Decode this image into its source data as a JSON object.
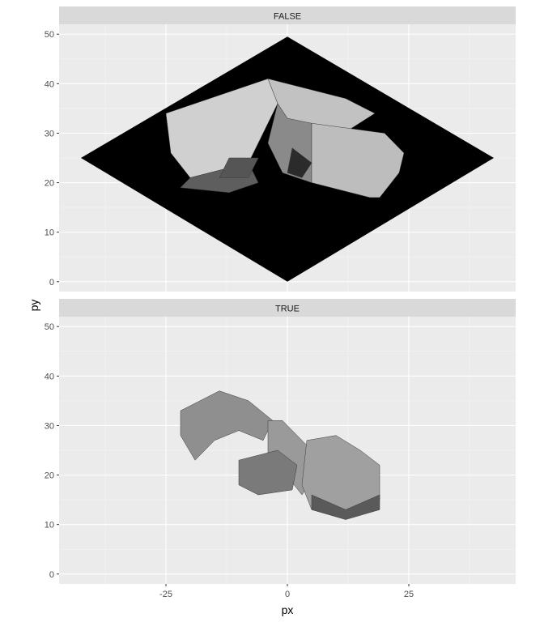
{
  "chart_data": {
    "type": "heatmap",
    "description_free": true,
    "xlabel": "px",
    "ylabel": "py",
    "xlim": [
      -47,
      47
    ],
    "ylim": [
      -2,
      52
    ],
    "x_ticks": [
      -25,
      0,
      25
    ],
    "x_tick_labels": [
      "-25",
      "0",
      "25"
    ],
    "y_ticks": [
      0,
      10,
      20,
      30,
      40,
      50
    ],
    "y_tick_labels": [
      "0",
      "10",
      "20",
      "30",
      "40",
      "50"
    ],
    "grid": true,
    "legend": "none",
    "facets": [
      {
        "strip_label": "FALSE",
        "ground_plane": [
          [
            0,
            0
          ],
          [
            42.5,
            25
          ],
          [
            0,
            49.5
          ],
          [
            -42.5,
            25
          ]
        ],
        "blocks": [
          {
            "x": [
              -25,
              -4,
              -2,
              -8,
              -20,
              -24
            ],
            "y": [
              34,
              41,
              36,
              24,
              21,
              26
            ],
            "shade": "#d0d0d0"
          },
          {
            "x": [
              -4,
              12,
              18,
              10,
              0,
              -2
            ],
            "y": [
              41,
              37,
              34,
              29,
              33,
              36
            ],
            "shade": "#c2c2c2"
          },
          {
            "x": [
              -2,
              0,
              5,
              5,
              -1,
              -4
            ],
            "y": [
              36,
              33,
              32,
              20,
              22,
              28
            ],
            "shade": "#8a8a8a"
          },
          {
            "x": [
              5,
              20,
              24,
              23,
              19,
              17,
              5
            ],
            "y": [
              32,
              30,
              26,
              22,
              17,
              17,
              20
            ],
            "shade": "#bdbdbd"
          },
          {
            "x": [
              -20,
              -8,
              -6,
              -12,
              -22
            ],
            "y": [
              21,
              24,
              20,
              18,
              19
            ],
            "shade": "#5e5e5e"
          },
          {
            "x": [
              -12,
              -6,
              -8,
              -14
            ],
            "y": [
              25,
              25,
              21,
              21
            ],
            "shade": "#555555"
          },
          {
            "x": [
              1,
              5,
              3,
              0
            ],
            "y": [
              27,
              24,
              21,
              22
            ],
            "shade": "#2b2b2b"
          }
        ]
      },
      {
        "strip_label": "TRUE",
        "ground_plane": [],
        "blocks": [
          {
            "x": [
              -22,
              -14,
              -8,
              -3,
              -5,
              -10,
              -15,
              -19,
              -22
            ],
            "y": [
              33,
              37,
              35,
              31,
              27,
              29,
              27,
              23,
              28
            ],
            "shade": "#8f8f8f"
          },
          {
            "x": [
              -4,
              -1,
              1,
              5,
              7,
              3,
              -1,
              -4
            ],
            "y": [
              31,
              31,
              29,
              25,
              22,
              16,
              21,
              24
            ],
            "shade": "#9a9a9a"
          },
          {
            "x": [
              -10,
              -2,
              2,
              1,
              -6,
              -10
            ],
            "y": [
              23,
              25,
              22,
              17,
              16,
              18
            ],
            "shade": "#7a7a7a"
          },
          {
            "x": [
              4,
              10,
              15,
              19,
              19,
              12,
              5,
              3
            ],
            "y": [
              27,
              28,
              25,
              22,
              15,
              12,
              13,
              18
            ],
            "shade": "#a0a0a0"
          },
          {
            "x": [
              5,
              12,
              19,
              19,
              12,
              5
            ],
            "y": [
              16,
              13,
              16,
              13,
              11,
              13
            ],
            "shade": "#5a5a5a"
          }
        ]
      }
    ]
  }
}
